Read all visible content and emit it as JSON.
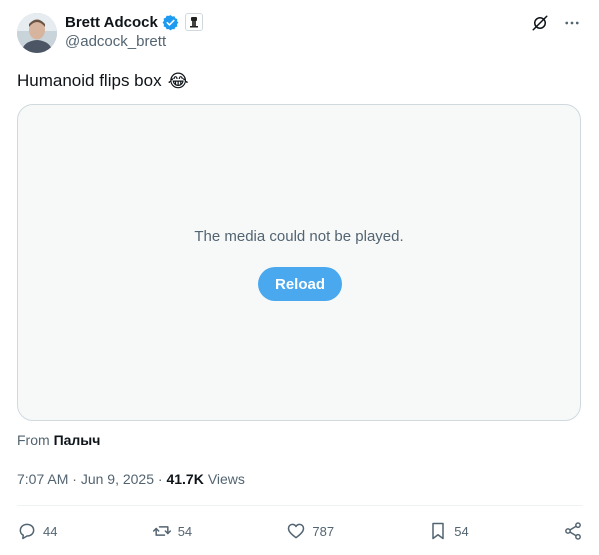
{
  "author": {
    "display_name": "Brett Adcock",
    "handle": "@adcock_brett",
    "verified_icon": "verified-badge-icon",
    "affiliate_icon": "robot-affiliate-icon"
  },
  "tweet": {
    "text": "Humanoid flips box",
    "emoji": "😂"
  },
  "media": {
    "error_text": "The media could not be played.",
    "reload_label": "Reload"
  },
  "source": {
    "prefix": "From",
    "name": "Палыч"
  },
  "meta": {
    "time": "7:07 AM",
    "separator": " · ",
    "date": "Jun 9, 2025",
    "views_count": "41.7K",
    "views_label": "Views"
  },
  "actions": {
    "replies": "44",
    "reposts": "54",
    "likes": "787",
    "bookmarks": "54"
  },
  "colors": {
    "accent": "#1d9bf0",
    "reload_button": "#4aa8ee",
    "muted_text": "#536471"
  }
}
